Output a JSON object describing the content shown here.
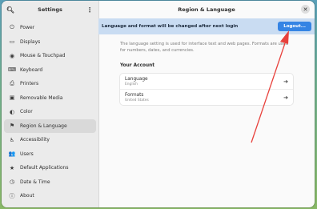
{
  "sidebar": {
    "title": "Settings",
    "items": [
      {
        "label": "Power",
        "icon": "power-icon",
        "glyph": "⏻"
      },
      {
        "label": "Displays",
        "icon": "display-icon",
        "glyph": "▭"
      },
      {
        "label": "Mouse & Touchpad",
        "icon": "mouse-icon",
        "glyph": "◉"
      },
      {
        "label": "Keyboard",
        "icon": "keyboard-icon",
        "glyph": "⌨"
      },
      {
        "label": "Printers",
        "icon": "printer-icon",
        "glyph": "⎙"
      },
      {
        "label": "Removable Media",
        "icon": "media-icon",
        "glyph": "▣"
      },
      {
        "label": "Color",
        "icon": "color-icon",
        "glyph": "◐"
      },
      {
        "label": "Region & Language",
        "icon": "region-icon",
        "glyph": "⚑",
        "active": true
      },
      {
        "label": "Accessibility",
        "icon": "accessibility-icon",
        "glyph": "♿"
      },
      {
        "label": "Users",
        "icon": "users-icon",
        "glyph": "👥"
      },
      {
        "label": "Default Applications",
        "icon": "star-icon",
        "glyph": "★"
      },
      {
        "label": "Date & Time",
        "icon": "clock-icon",
        "glyph": "◷"
      },
      {
        "label": "About",
        "icon": "info-icon",
        "glyph": "ⓘ"
      }
    ]
  },
  "header": {
    "title": "Region & Language"
  },
  "banner": {
    "message": "Language and format will be changed after next login",
    "button": "Logout..."
  },
  "content": {
    "description": "The language setting is used for interface text and web pages. Formats are used for numbers, dates, and currencies.",
    "section_title": "Your Account",
    "rows": [
      {
        "title": "Language",
        "subtitle": "English"
      },
      {
        "title": "Formats",
        "subtitle": "United States"
      }
    ]
  },
  "colors": {
    "accent": "#3584e4",
    "annotation": "#e8413c"
  }
}
